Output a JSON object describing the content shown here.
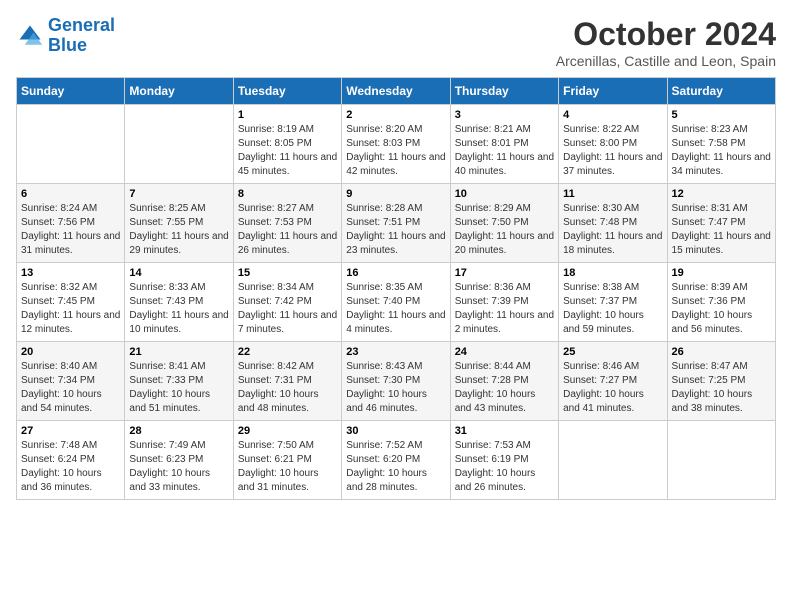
{
  "logo": {
    "line1": "General",
    "line2": "Blue"
  },
  "title": "October 2024",
  "location": "Arcenillas, Castille and Leon, Spain",
  "headers": [
    "Sunday",
    "Monday",
    "Tuesday",
    "Wednesday",
    "Thursday",
    "Friday",
    "Saturday"
  ],
  "weeks": [
    [
      {
        "num": "",
        "detail": ""
      },
      {
        "num": "",
        "detail": ""
      },
      {
        "num": "1",
        "detail": "Sunrise: 8:19 AM\nSunset: 8:05 PM\nDaylight: 11 hours and 45 minutes."
      },
      {
        "num": "2",
        "detail": "Sunrise: 8:20 AM\nSunset: 8:03 PM\nDaylight: 11 hours and 42 minutes."
      },
      {
        "num": "3",
        "detail": "Sunrise: 8:21 AM\nSunset: 8:01 PM\nDaylight: 11 hours and 40 minutes."
      },
      {
        "num": "4",
        "detail": "Sunrise: 8:22 AM\nSunset: 8:00 PM\nDaylight: 11 hours and 37 minutes."
      },
      {
        "num": "5",
        "detail": "Sunrise: 8:23 AM\nSunset: 7:58 PM\nDaylight: 11 hours and 34 minutes."
      }
    ],
    [
      {
        "num": "6",
        "detail": "Sunrise: 8:24 AM\nSunset: 7:56 PM\nDaylight: 11 hours and 31 minutes."
      },
      {
        "num": "7",
        "detail": "Sunrise: 8:25 AM\nSunset: 7:55 PM\nDaylight: 11 hours and 29 minutes."
      },
      {
        "num": "8",
        "detail": "Sunrise: 8:27 AM\nSunset: 7:53 PM\nDaylight: 11 hours and 26 minutes."
      },
      {
        "num": "9",
        "detail": "Sunrise: 8:28 AM\nSunset: 7:51 PM\nDaylight: 11 hours and 23 minutes."
      },
      {
        "num": "10",
        "detail": "Sunrise: 8:29 AM\nSunset: 7:50 PM\nDaylight: 11 hours and 20 minutes."
      },
      {
        "num": "11",
        "detail": "Sunrise: 8:30 AM\nSunset: 7:48 PM\nDaylight: 11 hours and 18 minutes."
      },
      {
        "num": "12",
        "detail": "Sunrise: 8:31 AM\nSunset: 7:47 PM\nDaylight: 11 hours and 15 minutes."
      }
    ],
    [
      {
        "num": "13",
        "detail": "Sunrise: 8:32 AM\nSunset: 7:45 PM\nDaylight: 11 hours and 12 minutes."
      },
      {
        "num": "14",
        "detail": "Sunrise: 8:33 AM\nSunset: 7:43 PM\nDaylight: 11 hours and 10 minutes."
      },
      {
        "num": "15",
        "detail": "Sunrise: 8:34 AM\nSunset: 7:42 PM\nDaylight: 11 hours and 7 minutes."
      },
      {
        "num": "16",
        "detail": "Sunrise: 8:35 AM\nSunset: 7:40 PM\nDaylight: 11 hours and 4 minutes."
      },
      {
        "num": "17",
        "detail": "Sunrise: 8:36 AM\nSunset: 7:39 PM\nDaylight: 11 hours and 2 minutes."
      },
      {
        "num": "18",
        "detail": "Sunrise: 8:38 AM\nSunset: 7:37 PM\nDaylight: 10 hours and 59 minutes."
      },
      {
        "num": "19",
        "detail": "Sunrise: 8:39 AM\nSunset: 7:36 PM\nDaylight: 10 hours and 56 minutes."
      }
    ],
    [
      {
        "num": "20",
        "detail": "Sunrise: 8:40 AM\nSunset: 7:34 PM\nDaylight: 10 hours and 54 minutes."
      },
      {
        "num": "21",
        "detail": "Sunrise: 8:41 AM\nSunset: 7:33 PM\nDaylight: 10 hours and 51 minutes."
      },
      {
        "num": "22",
        "detail": "Sunrise: 8:42 AM\nSunset: 7:31 PM\nDaylight: 10 hours and 48 minutes."
      },
      {
        "num": "23",
        "detail": "Sunrise: 8:43 AM\nSunset: 7:30 PM\nDaylight: 10 hours and 46 minutes."
      },
      {
        "num": "24",
        "detail": "Sunrise: 8:44 AM\nSunset: 7:28 PM\nDaylight: 10 hours and 43 minutes."
      },
      {
        "num": "25",
        "detail": "Sunrise: 8:46 AM\nSunset: 7:27 PM\nDaylight: 10 hours and 41 minutes."
      },
      {
        "num": "26",
        "detail": "Sunrise: 8:47 AM\nSunset: 7:25 PM\nDaylight: 10 hours and 38 minutes."
      }
    ],
    [
      {
        "num": "27",
        "detail": "Sunrise: 7:48 AM\nSunset: 6:24 PM\nDaylight: 10 hours and 36 minutes."
      },
      {
        "num": "28",
        "detail": "Sunrise: 7:49 AM\nSunset: 6:23 PM\nDaylight: 10 hours and 33 minutes."
      },
      {
        "num": "29",
        "detail": "Sunrise: 7:50 AM\nSunset: 6:21 PM\nDaylight: 10 hours and 31 minutes."
      },
      {
        "num": "30",
        "detail": "Sunrise: 7:52 AM\nSunset: 6:20 PM\nDaylight: 10 hours and 28 minutes."
      },
      {
        "num": "31",
        "detail": "Sunrise: 7:53 AM\nSunset: 6:19 PM\nDaylight: 10 hours and 26 minutes."
      },
      {
        "num": "",
        "detail": ""
      },
      {
        "num": "",
        "detail": ""
      }
    ]
  ]
}
